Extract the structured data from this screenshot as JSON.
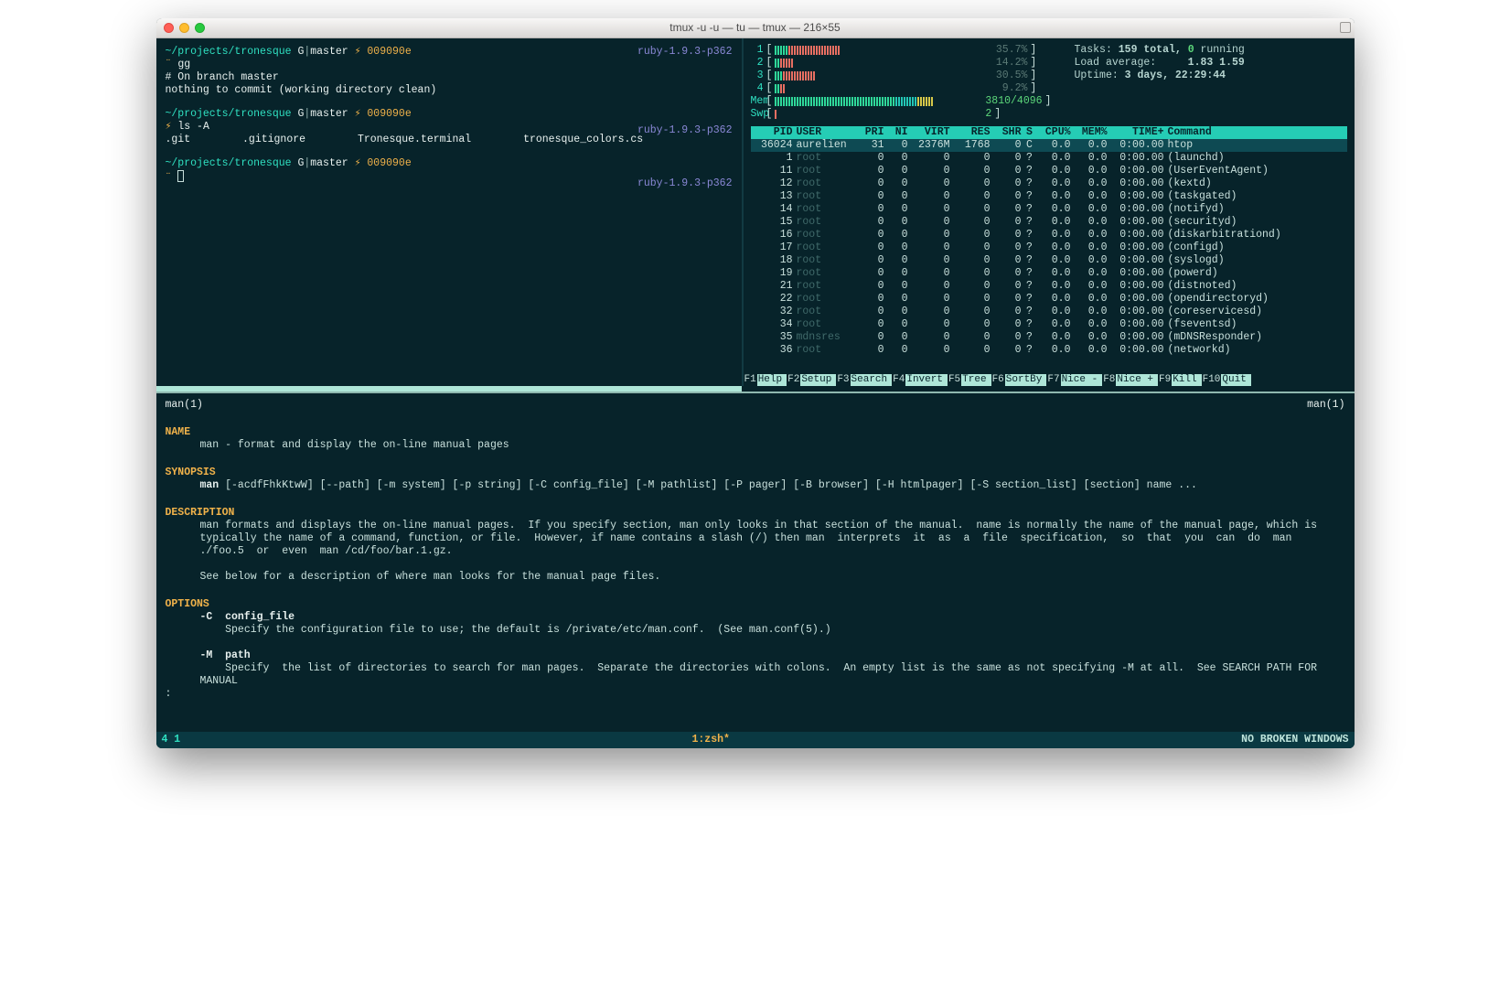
{
  "window": {
    "title": "tmux -u -u — tu — tmux — 216×55"
  },
  "shell": {
    "prompts": [
      {
        "path": "~/projects/tronesque",
        "vcs": "G",
        "branch": "master",
        "hash": "009090e",
        "ruby": "ruby-1.9.3-p362",
        "cmd_prefix": "¨",
        "cmd": "gg",
        "output": [
          "# On branch master",
          "nothing to commit (working directory clean)"
        ]
      },
      {
        "path": "~/projects/tronesque",
        "vcs": "G",
        "branch": "master",
        "hash": "009090e",
        "ruby": "ruby-1.9.3-p362",
        "cmd_prefix": "⚡",
        "cmd": "ls -A",
        "output_ls": [
          ".git",
          ".gitignore",
          "Tronesque.terminal",
          "tronesque_colors.cs"
        ]
      },
      {
        "path": "~/projects/tronesque",
        "vcs": "G",
        "branch": "master",
        "hash": "009090e",
        "ruby": "ruby-1.9.3-p362",
        "cmd_prefix": "¨",
        "cmd": ""
      }
    ]
  },
  "htop": {
    "cpus": [
      {
        "idx": "1",
        "pct": "35.7%"
      },
      {
        "idx": "2",
        "pct": "14.2%"
      },
      {
        "idx": "3",
        "pct": "30.5%"
      },
      {
        "idx": "4",
        "pct": "9.2%"
      }
    ],
    "mem": {
      "label": "Mem",
      "used": "3810",
      "total": "4096"
    },
    "swp": {
      "label": "Swp",
      "used": "2",
      "total": ""
    },
    "tasks_label": "Tasks:",
    "tasks_total": "159 total,",
    "tasks_running_n": "0",
    "tasks_running": "running",
    "load_label": "Load average:",
    "load_values": "1.83 1.59",
    "uptime_label": "Uptime:",
    "uptime_value": "3 days, 22:29:44",
    "columns": [
      "PID",
      "USER",
      "PRI",
      "NI",
      "VIRT",
      "RES",
      "SHR",
      "S",
      "CPU%",
      "MEM%",
      "TIME+",
      "Command"
    ],
    "selected_pid": "36024",
    "rows": [
      {
        "pid": "36024",
        "user": "aurelien",
        "pri": "31",
        "ni": "0",
        "virt": "2376M",
        "res": "1768",
        "shr": "0",
        "s": "C",
        "cpu": "0.0",
        "mem": "0.0",
        "time": "0:00.00",
        "cmd": "htop"
      },
      {
        "pid": "1",
        "user": "root",
        "pri": "0",
        "ni": "0",
        "virt": "0",
        "res": "0",
        "shr": "0",
        "s": "?",
        "cpu": "0.0",
        "mem": "0.0",
        "time": "0:00.00",
        "cmd": "(launchd)"
      },
      {
        "pid": "11",
        "user": "root",
        "pri": "0",
        "ni": "0",
        "virt": "0",
        "res": "0",
        "shr": "0",
        "s": "?",
        "cpu": "0.0",
        "mem": "0.0",
        "time": "0:00.00",
        "cmd": "(UserEventAgent)"
      },
      {
        "pid": "12",
        "user": "root",
        "pri": "0",
        "ni": "0",
        "virt": "0",
        "res": "0",
        "shr": "0",
        "s": "?",
        "cpu": "0.0",
        "mem": "0.0",
        "time": "0:00.00",
        "cmd": "(kextd)"
      },
      {
        "pid": "13",
        "user": "root",
        "pri": "0",
        "ni": "0",
        "virt": "0",
        "res": "0",
        "shr": "0",
        "s": "?",
        "cpu": "0.0",
        "mem": "0.0",
        "time": "0:00.00",
        "cmd": "(taskgated)"
      },
      {
        "pid": "14",
        "user": "root",
        "pri": "0",
        "ni": "0",
        "virt": "0",
        "res": "0",
        "shr": "0",
        "s": "?",
        "cpu": "0.0",
        "mem": "0.0",
        "time": "0:00.00",
        "cmd": "(notifyd)"
      },
      {
        "pid": "15",
        "user": "root",
        "pri": "0",
        "ni": "0",
        "virt": "0",
        "res": "0",
        "shr": "0",
        "s": "?",
        "cpu": "0.0",
        "mem": "0.0",
        "time": "0:00.00",
        "cmd": "(securityd)"
      },
      {
        "pid": "16",
        "user": "root",
        "pri": "0",
        "ni": "0",
        "virt": "0",
        "res": "0",
        "shr": "0",
        "s": "?",
        "cpu": "0.0",
        "mem": "0.0",
        "time": "0:00.00",
        "cmd": "(diskarbitrationd)"
      },
      {
        "pid": "17",
        "user": "root",
        "pri": "0",
        "ni": "0",
        "virt": "0",
        "res": "0",
        "shr": "0",
        "s": "?",
        "cpu": "0.0",
        "mem": "0.0",
        "time": "0:00.00",
        "cmd": "(configd)"
      },
      {
        "pid": "18",
        "user": "root",
        "pri": "0",
        "ni": "0",
        "virt": "0",
        "res": "0",
        "shr": "0",
        "s": "?",
        "cpu": "0.0",
        "mem": "0.0",
        "time": "0:00.00",
        "cmd": "(syslogd)"
      },
      {
        "pid": "19",
        "user": "root",
        "pri": "0",
        "ni": "0",
        "virt": "0",
        "res": "0",
        "shr": "0",
        "s": "?",
        "cpu": "0.0",
        "mem": "0.0",
        "time": "0:00.00",
        "cmd": "(powerd)"
      },
      {
        "pid": "21",
        "user": "root",
        "pri": "0",
        "ni": "0",
        "virt": "0",
        "res": "0",
        "shr": "0",
        "s": "?",
        "cpu": "0.0",
        "mem": "0.0",
        "time": "0:00.00",
        "cmd": "(distnoted)"
      },
      {
        "pid": "22",
        "user": "root",
        "pri": "0",
        "ni": "0",
        "virt": "0",
        "res": "0",
        "shr": "0",
        "s": "?",
        "cpu": "0.0",
        "mem": "0.0",
        "time": "0:00.00",
        "cmd": "(opendirectoryd)"
      },
      {
        "pid": "32",
        "user": "root",
        "pri": "0",
        "ni": "0",
        "virt": "0",
        "res": "0",
        "shr": "0",
        "s": "?",
        "cpu": "0.0",
        "mem": "0.0",
        "time": "0:00.00",
        "cmd": "(coreservicesd)"
      },
      {
        "pid": "34",
        "user": "root",
        "pri": "0",
        "ni": "0",
        "virt": "0",
        "res": "0",
        "shr": "0",
        "s": "?",
        "cpu": "0.0",
        "mem": "0.0",
        "time": "0:00.00",
        "cmd": "(fseventsd)"
      },
      {
        "pid": "35",
        "user": "mdnsres",
        "pri": "0",
        "ni": "0",
        "virt": "0",
        "res": "0",
        "shr": "0",
        "s": "?",
        "cpu": "0.0",
        "mem": "0.0",
        "time": "0:00.00",
        "cmd": "(mDNSResponder)"
      },
      {
        "pid": "36",
        "user": "root",
        "pri": "0",
        "ni": "0",
        "virt": "0",
        "res": "0",
        "shr": "0",
        "s": "?",
        "cpu": "0.0",
        "mem": "0.0",
        "time": "0:00.00",
        "cmd": "(networkd)"
      }
    ],
    "fkeys": [
      {
        "key": "F1",
        "label": "Help "
      },
      {
        "key": "F2",
        "label": "Setup"
      },
      {
        "key": "F3",
        "label": "Search"
      },
      {
        "key": "F4",
        "label": "Invert"
      },
      {
        "key": "F5",
        "label": "Tree "
      },
      {
        "key": "F6",
        "label": "SortBy"
      },
      {
        "key": "F7",
        "label": "Nice -"
      },
      {
        "key": "F8",
        "label": "Nice +"
      },
      {
        "key": "F9",
        "label": "Kill "
      },
      {
        "key": "F10",
        "label": "Quit"
      }
    ]
  },
  "man": {
    "header_left": "man(1)",
    "header_right": "man(1)",
    "sec_name": "NAME",
    "name_line": "man - format and display the on-line manual pages",
    "sec_synopsis": "SYNOPSIS",
    "synopsis_pre": "man",
    "synopsis_rest": " [-acdfFhkKtwW] [--path] [-m system] [-p string] [-C config_file] [-M pathlist] [-P pager] [-B browser] [-H htmlpager] [-S section_list] [section] name ...",
    "sec_description": "DESCRIPTION",
    "desc_1": "man formats and displays the on-line manual pages.  If you specify section, man only looks in that section of the manual.  name is normally the name of the manual page, which is typically the name of a command, function, or file.  However, if name contains a slash (/) then man  interprets  it  as  a  file  specification,  so  that  you  can  do  man  ./foo.5  or  even  man /cd/foo/bar.1.gz.",
    "desc_2": "See below for a description of where man looks for the manual page files.",
    "sec_options": "OPTIONS",
    "opt_c_flag": "-C  config_file",
    "opt_c_desc": "Specify the configuration file to use; the default is /private/etc/man.conf.  (See man.conf(5).)",
    "opt_m_flag": "-M  path",
    "opt_m_desc": "Specify  the list of directories to search for man pages.  Separate the directories with colons.  An empty list is the same as not specifying -M at all.  See SEARCH PATH FOR MANUAL",
    "colon": ":"
  },
  "status": {
    "left": "4 1",
    "center": "1:zsh*",
    "right": "NO BROKEN WINDOWS"
  }
}
